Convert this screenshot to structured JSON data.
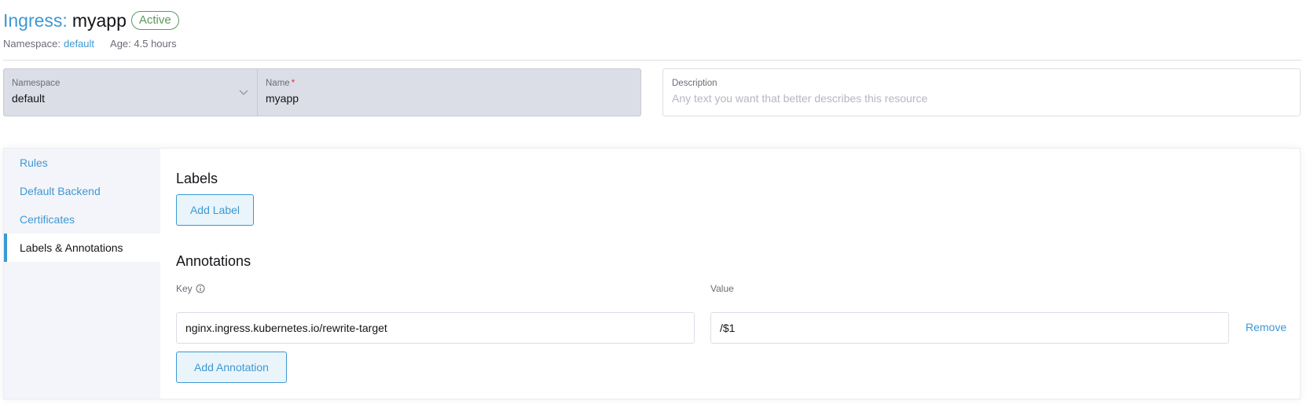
{
  "header": {
    "type_label": "Ingress:",
    "name": "myapp",
    "status": "Active",
    "namespace_label": "Namespace:",
    "namespace_value": "default",
    "age_text": "Age: 4.5 hours"
  },
  "form": {
    "namespace_label": "Namespace",
    "namespace_value": "default",
    "name_label": "Name",
    "name_required_mark": "*",
    "name_value": "myapp",
    "description_label": "Description",
    "description_placeholder": "Any text you want that better describes this resource"
  },
  "sidebar": {
    "items": [
      {
        "label": "Rules"
      },
      {
        "label": "Default Backend"
      },
      {
        "label": "Certificates"
      },
      {
        "label": "Labels & Annotations"
      }
    ]
  },
  "labels": {
    "title": "Labels",
    "add_button": "Add Label"
  },
  "annotations": {
    "title": "Annotations",
    "key_label": "Key",
    "value_label": "Value",
    "rows": [
      {
        "key": "nginx.ingress.kubernetes.io/rewrite-target",
        "value": "/$1",
        "remove": "Remove"
      }
    ],
    "add_button": "Add Annotation"
  },
  "colors": {
    "accent": "#3d98d3",
    "active_badge": "#5d995d",
    "required": "#d4373c"
  }
}
